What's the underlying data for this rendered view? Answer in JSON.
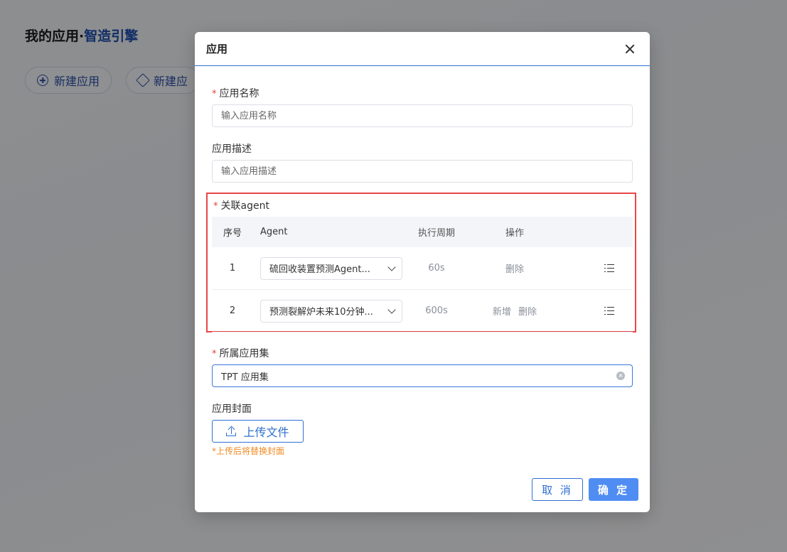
{
  "background": {
    "title_prefix": "我的应用·",
    "title_accent": "智造引擎",
    "buttons": [
      "新建应用",
      "新建应"
    ]
  },
  "modal": {
    "title": "应用",
    "required_mark": "*",
    "app_name": {
      "label": "应用名称",
      "placeholder": "输入应用名称",
      "value": ""
    },
    "app_desc": {
      "label": "应用描述",
      "placeholder": "输入应用描述",
      "value": ""
    },
    "agent": {
      "label": "关联agent",
      "columns": {
        "seq": "序号",
        "agent": "Agent",
        "cycle": "执行周期",
        "op": "操作"
      },
      "rows": [
        {
          "seq": "1",
          "agent": "硫回收装置预测Agent...",
          "cycle": "60s",
          "ops": [
            "删除"
          ]
        },
        {
          "seq": "2",
          "agent": "预测裂解炉未来10分钟...",
          "cycle": "600s",
          "ops": [
            "新增",
            "删除"
          ]
        }
      ]
    },
    "app_set": {
      "label": "所属应用集",
      "value": "TPT 应用集"
    },
    "cover": {
      "label": "应用封面",
      "upload_label": "上传文件",
      "hint": "*上传后将替换封面"
    },
    "footer": {
      "cancel": "取 消",
      "ok": "确 定"
    }
  },
  "colors": {
    "accent": "#2f6fd0",
    "primary_button": "#4f8df2",
    "highlight_border": "#e84646",
    "hint": "#f08a24",
    "required": "#e0453b"
  }
}
